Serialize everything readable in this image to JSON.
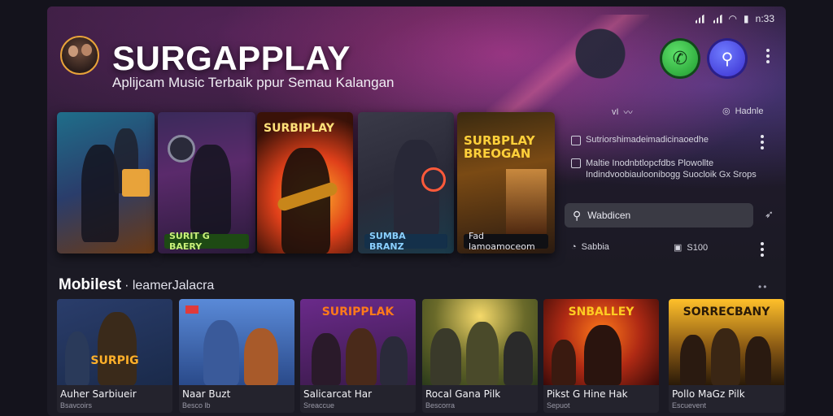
{
  "status_bar": {
    "time": "n:33",
    "icons": [
      "signal-icon",
      "signal-icon",
      "wifi-icon",
      "battery-icon"
    ]
  },
  "header": {
    "app_name": "SURGAPPLAY",
    "tagline": "Aplijcam Music Terbaik ppur Semau Kalangan",
    "call_icon": "phone-icon",
    "search_icon": "search-icon"
  },
  "featured": [
    {
      "label": "",
      "caption": "",
      "accent": "#e8a33a"
    },
    {
      "label": "",
      "caption": "SURIT G BAERY",
      "accent": "#7fd14a"
    },
    {
      "label": "SURBIPLAY",
      "caption": "",
      "accent": "#ff6a1a"
    },
    {
      "label": "",
      "caption": "SUMBA BRANZ",
      "accent": "#4aa8ff"
    },
    {
      "label": "SURBPLAY BREOGAN",
      "caption": "Fad lamoamoceom",
      "accent": "#ffb02a"
    }
  ],
  "side": {
    "top_left_link": "vI",
    "top_right_link": "Hadnle",
    "rows": [
      {
        "text": "Sutriorshimadeimadicinaoedhe"
      },
      {
        "text": "Maltie Inodnbtlopcfdbs Plowollte Indindvoobiauloonibogg Suocloik Gx Srops"
      }
    ],
    "search_placeholder": "Wabdicen",
    "footer_left": "Sabbia",
    "footer_right": "S100"
  },
  "section": {
    "title": "Mobilest",
    "subtitle": "· leamerJalacra",
    "more": "••"
  },
  "cards": [
    {
      "thumb_text": "SURPIG",
      "title": "Auher Sarbiueir",
      "meta": "Bsavcoirs",
      "bg": "#2a3d6b",
      "accent": "#ffb02a"
    },
    {
      "thumb_text": "",
      "title": "Naar Buzt",
      "meta": "Besco lb",
      "bg": "#3d5fa8",
      "accent": "#ffcc33"
    },
    {
      "thumb_text": "SURIPPLAK",
      "title": "Salicarcat Har",
      "meta": "Sreaccue",
      "bg": "#4a2a6b",
      "accent": "#ff7a1a"
    },
    {
      "thumb_text": "",
      "title": "Rocal Gana Pilk",
      "meta": "Bescorra",
      "bg": "#5a6a2a",
      "accent": "#f5d96a"
    },
    {
      "thumb_text": "SNBALLEY",
      "title": "Pikst G Hine Hak",
      "meta": "Sepuot",
      "bg": "#7a1a14",
      "accent": "#ffcc22"
    },
    {
      "thumb_text": "SORRECBANY",
      "title": "Pollo MaGz Pilk",
      "meta": "Escuevent",
      "bg": "#5a3a14",
      "accent": "#ffb02a"
    }
  ],
  "colors": {
    "background": "#1b1a24",
    "call_green": "#1f9a2e",
    "search_blue": "#3a2fd0"
  }
}
